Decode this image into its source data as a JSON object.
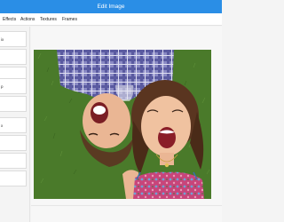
{
  "window": {
    "title": "Edit Image"
  },
  "toolbar": {
    "tabs": [
      {
        "label": "Effects"
      },
      {
        "label": "Actions"
      },
      {
        "label": "Textures"
      },
      {
        "label": "Frames"
      }
    ]
  },
  "sidebar": {
    "items": [
      {
        "label": "ix"
      },
      {
        "label": ""
      },
      {
        "label": ""
      },
      {
        "label": "p"
      },
      {
        "label": ""
      },
      {
        "label": "x"
      },
      {
        "label": ""
      },
      {
        "label": ""
      },
      {
        "label": ""
      }
    ]
  },
  "photo": {
    "subject": "two laughing children lying on grass",
    "colors": {
      "grass": "#4a7a2a",
      "shirt": "#6f6fae",
      "dress": "#cf4f7d"
    }
  },
  "colors": {
    "titlebar": "#2a8ee6",
    "toolbar": "#ffffff",
    "background": "#f4f4f4"
  }
}
